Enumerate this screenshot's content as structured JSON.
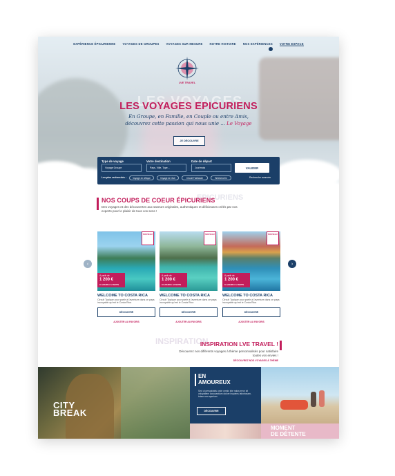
{
  "nav": {
    "items": [
      "EXPÉRIENCE ÉPICURIENNE",
      "VOYAGES DE GROUPES",
      "VOYAGES SUR MESURE",
      "NOTRE HISTOIRE",
      "NOS EXPÉRIENCES"
    ],
    "espace": "VOTRE ESPACE"
  },
  "logo": {
    "text": "LVE TRAVEL"
  },
  "hero": {
    "ghost_title": "LES VOYAGES",
    "title": "LES VOYAGES EPICURIENS",
    "subtitle_line1": "En Groupe, en Famille, en Couple ou entre Amis,",
    "subtitle_line2": "découvrez cette passion qui nous unie ...",
    "subtitle_highlight": "Le Voyage",
    "button": "JE DÉCOUVRE"
  },
  "search": {
    "type_label": "Type de voyage",
    "type_value": "Voyage Groupe",
    "destination_label": "Votre destination",
    "destination_placeholder": "Pays, Ville, Type...",
    "date_label": "Date de départ",
    "date_value": "Jour/mois",
    "submit": "VALIDER",
    "popular_label": "Les plus recherchés :",
    "tags": [
      "Voyage en Afrique",
      "Voyage de rêve",
      "Circuit Thaïlande",
      "Weekend lin"
    ],
    "advanced": "Recherche avancée"
  },
  "coups": {
    "ghost": "EPICURIENS",
    "title": "NOS COUPS DE COEUR ÉPICURIENS",
    "desc": "Des voyages et des découvertes aux saveurs originales, authentiques et délicieuses créés par nos experts pour le plaisir de tous vos sens !"
  },
  "cards": [
    {
      "ribbon": "NOUVEAU",
      "from": "À partir de",
      "price": "1 200 €",
      "duration": "10 JOURS / 12 NUITS",
      "title": "WELCOME TO COSTA RICA",
      "desc": "Circuit Typique pour partir à l'aventure dans ce pays incroyable qu'est le Costa Rica",
      "button": "DÉCOUVRIR",
      "fav": "AJOUTER AU FAVORIS"
    },
    {
      "ribbon": "NOUVEAU",
      "from": "À partir de",
      "price": "1 200 €",
      "duration": "10 JOURS / 12 NUITS",
      "title": "WELCOME TO COSTA RICA",
      "desc": "Circuit Typique pour partir à l'aventure dans ce pays incroyable qu'est le Costa Rica",
      "button": "DÉCOUVRIR",
      "fav": "AJOUTER AU FAVORIS"
    },
    {
      "ribbon": "NOUVEAU",
      "from": "À partir de",
      "price": "1 200 €",
      "duration": "10 JOURS / 12 NUITS",
      "title": "WELCOME TO COSTA RICA",
      "desc": "Circuit Typique pour partir à l'aventure dans ce pays incroyable qu'est le Costa Rica",
      "button": "DÉCOUVRIR",
      "fav": "AJOUTER AU FAVORIS"
    }
  ],
  "arrows": {
    "prev": "‹",
    "next": "›"
  },
  "inspiration": {
    "ghost": "INSPIRATION",
    "title": "INSPIRATION LVE TRAVEL !",
    "desc": "Découvrez nos différents voyages à thème personnalisés pour satisfaire toutes vos envies !",
    "link": "DÉCOUVREZ NOS VOYAGES À THÈME"
  },
  "tiles": {
    "city": "CITY BREAK",
    "amour_title_1": "EN",
    "amour_title_2": "AMOUREUX",
    "amour_desc": "Sed ut perspiciatis unde omnis iste natus error sit voluptatem accusantium dolore inquiens laboriosam, totam rem aperiam",
    "amour_button": "DÉCOUVRIR",
    "detente_1": "MOMENT",
    "detente_2": "DE DÉTENTE"
  },
  "colors": {
    "navy": "#1b3f68",
    "pink": "#c21d5b",
    "teal": "#2a8f9a"
  }
}
